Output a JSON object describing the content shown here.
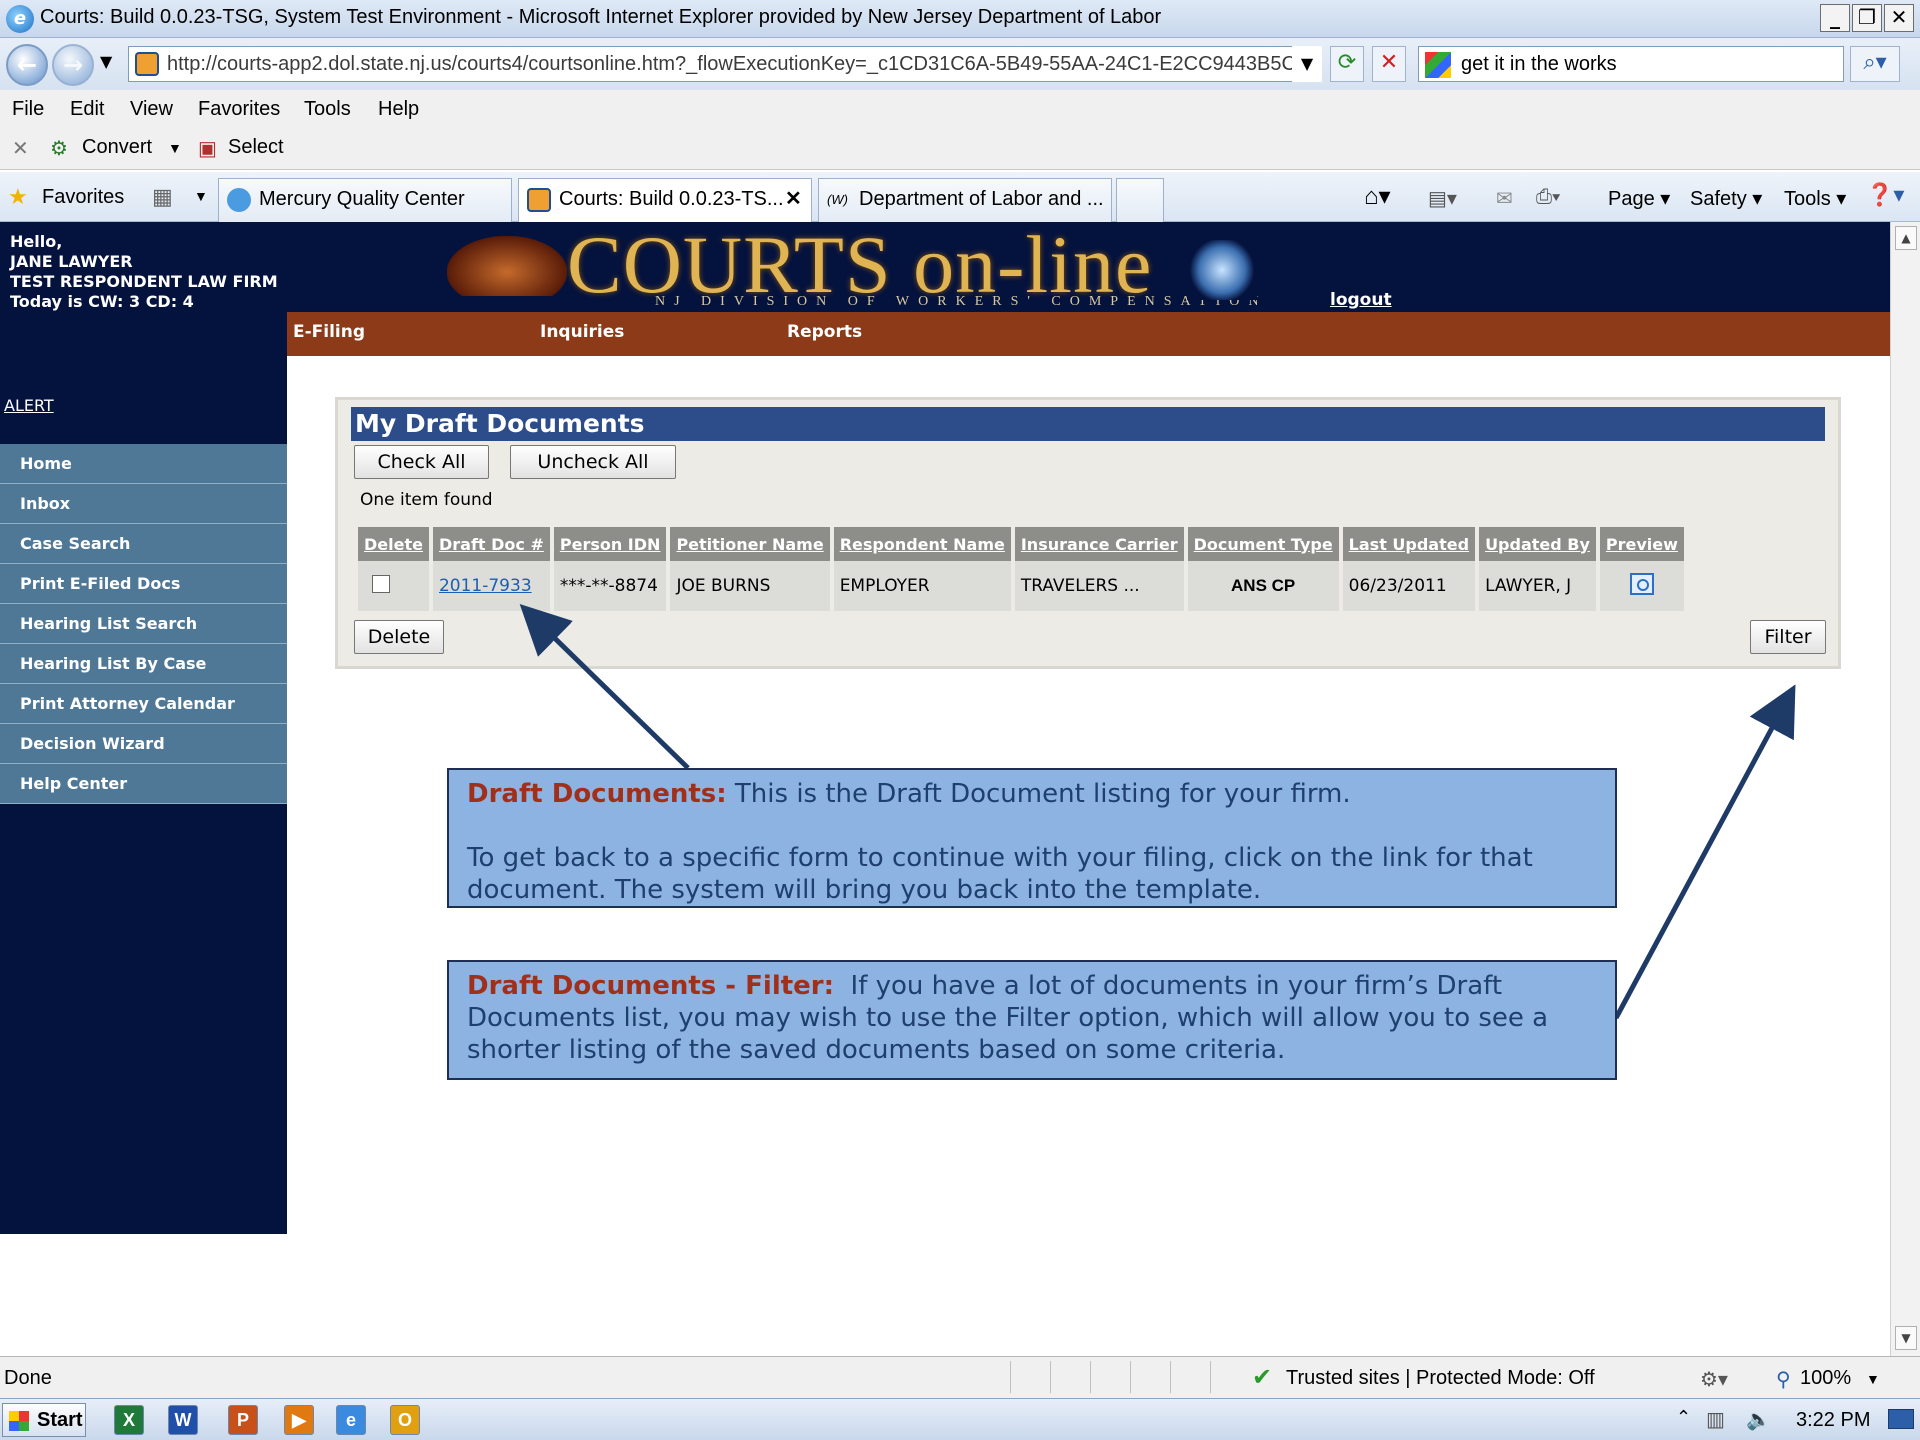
{
  "browser": {
    "title": "Courts: Build 0.0.23-TSG, System Test Environment - Microsoft Internet Explorer provided by New Jersey Department of Labor",
    "url": "http://courts-app2.dol.state.nj.us/courts4/courtsonline.htm?_flowExecutionKey=_c1CD31C6A-5B49-55AA-24C1-E2CC9443B5C1_",
    "search": "get it in the works",
    "menu": [
      "File",
      "Edit",
      "View",
      "Favorites",
      "Tools",
      "Help"
    ],
    "cmd": {
      "convert": "Convert",
      "select": "Select"
    },
    "favorites_label": "Favorites",
    "tabs": [
      "Mercury Quality Center",
      "Courts: Build 0.0.23-TS...",
      "Department of Labor and ..."
    ],
    "toolbar_right": [
      "Page",
      "Safety",
      "Tools"
    ]
  },
  "page": {
    "hello": [
      "Hello,",
      "JANE LAWYER",
      "TEST RESPONDENT LAW FIRM",
      "Today is CW: 3 CD: 4"
    ],
    "alert": "ALERT",
    "logo_text": "COURTS on-line",
    "logo_sub": "NJ DIVISION OF WORKERS' COMPENSATION",
    "logout": "logout",
    "topnav": [
      "E-Filing",
      "Inquiries",
      "Reports"
    ],
    "nav": [
      "Home",
      "Inbox",
      "Case Search",
      "Print E-Filed Docs",
      "Hearing List Search",
      "Hearing List By Case",
      "Print Attorney Calendar",
      "Decision Wizard",
      "Help Center"
    ]
  },
  "panel": {
    "title": "My Draft Documents",
    "check_all": "Check All",
    "uncheck_all": "Uncheck All",
    "found": "One item found",
    "columns": [
      "Delete",
      "Draft Doc #",
      "Person IDN",
      "Petitioner Name",
      "Respondent Name",
      "Insurance Carrier",
      "Document Type",
      "Last Updated",
      "Updated By",
      "Preview"
    ],
    "rows": [
      [
        "",
        "2011-7933",
        "***-**-8874",
        "JOE BURNS",
        "EMPLOYER",
        "TRAVELERS ...",
        "ANS CP",
        "06/23/2011",
        "LAWYER, J",
        ""
      ]
    ],
    "delete_button": "Delete",
    "filter_button": "Filter"
  },
  "callouts": [
    {
      "heading": "Draft Documents:",
      "p1": "This is the Draft Document listing for your firm.",
      "p2": "To get back to a specific form to continue with your filing, click on the link for that document. The system will bring you back into the template."
    },
    {
      "heading": "Draft Documents - Filter:",
      "p1": "If you have a lot of documents in your firm’s Draft Documents list, you may wish to use the Filter option, which will allow you to see a shorter listing of the saved documents based on some criteria."
    }
  ],
  "status": {
    "left": "Done",
    "zone": "Trusted sites | Protected Mode: Off",
    "zoom": "100%"
  },
  "taskbar": {
    "start": "Start",
    "clock": "3:22 PM"
  }
}
